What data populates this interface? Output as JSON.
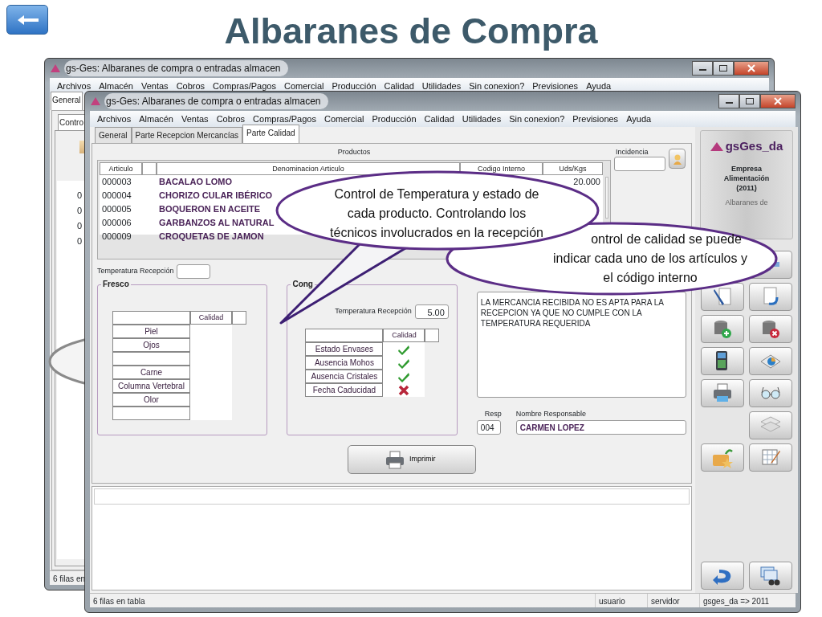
{
  "slide_title": "Albaranes de Compra",
  "back_window": {
    "title": "gs-Ges: Albaranes de compra o entradas almacen",
    "menu": [
      "Archivos",
      "Almacén",
      "Ventas",
      "Cobros",
      "Compras/Pagos",
      "Comercial",
      "Producción",
      "Calidad",
      "Utilidades",
      "Sin conexion?",
      "Previsiones",
      "Ayuda"
    ],
    "tabs": [
      {
        "label": "General",
        "selected": true
      }
    ],
    "subtabs": [
      {
        "label": "Contro",
        "selected": true
      }
    ],
    "column_cells": [
      "0",
      "0",
      "0",
      "0"
    ],
    "status": "6 filas en"
  },
  "window": {
    "title": "gs-Ges: Albaranes de compra o entradas almacen",
    "menu": [
      "Archivos",
      "Almacén",
      "Ventas",
      "Cobros",
      "Compras/Pagos",
      "Comercial",
      "Producción",
      "Calidad",
      "Utilidades",
      "Sin conexion?",
      "Previsiones",
      "Ayuda"
    ],
    "tabs": [
      {
        "label": "General",
        "selected": false
      },
      {
        "label": "Parte Recepcion Mercancías",
        "selected": false
      },
      {
        "label": "Parte Calidad",
        "selected": true
      }
    ],
    "products": {
      "title": "Productos",
      "columns": [
        "Articulo",
        "Denominacion Articulo",
        "Codigo Interno",
        "Uds/Kgs"
      ],
      "rows": [
        {
          "articulo": "000003",
          "denominacion": "BACALAO LOMO",
          "uds": "20.000"
        },
        {
          "articulo": "000004",
          "denominacion": "CHORIZO CULAR IBÉRICO"
        },
        {
          "articulo": "000005",
          "denominacion": "BOQUERON EN ACEITE"
        },
        {
          "articulo": "000006",
          "denominacion": "GARBANZOS AL NATURAL"
        },
        {
          "articulo": "000009",
          "denominacion": "CROQUETAS DE JAMON"
        }
      ]
    },
    "incidencia_label": "Incidencia",
    "temperature_label": "Temperatura Recepción",
    "fresco": {
      "legend": "Fresco",
      "header": "Calidad",
      "rows": [
        "Piel",
        "Ojos",
        null,
        "Carne",
        "Columna Vertebral",
        "Olor",
        null
      ]
    },
    "congelado": {
      "legend": "Cong",
      "temperature_label": "Temperatura Recepción",
      "temperature": "5.00",
      "header": "Calidad",
      "rows": [
        {
          "label": "Estado Envases",
          "ok": true
        },
        {
          "label": "Ausencia Mohos",
          "ok": true
        },
        {
          "label": "Ausencia Cristales",
          "ok": true
        },
        {
          "label": "Fecha Caducidad",
          "ok": false
        }
      ]
    },
    "incidencia_text": "LA MERCANCIA RECIBIDA NO ES APTA PARA LA RECEPCION YA QUE NO CUMPLE CON LA TEMPERATURA REQUERIDA",
    "resp_label": "Resp",
    "resp_value": "004",
    "nombre_label": "Nombre Responsable",
    "nombre_value": "CARMEN LOPEZ",
    "print_button": "Imprimir",
    "logo": {
      "brand": "gsGes_da",
      "company": "Empresa Alimentación (2011)",
      "module": "Albaranes de"
    },
    "status_bar": [
      "6 filas en tabla",
      "usuario",
      "servidor",
      "gsges_da => 2011"
    ]
  },
  "callouts": [
    {
      "text": "Control de Temperatura y estado de\ncada producto. Controlando los\ntécnicos involucrados en la recepción"
    },
    {
      "text": "ontrol de calidad se puede\nindicar cada uno de los artículos y\nel código interno"
    }
  ]
}
